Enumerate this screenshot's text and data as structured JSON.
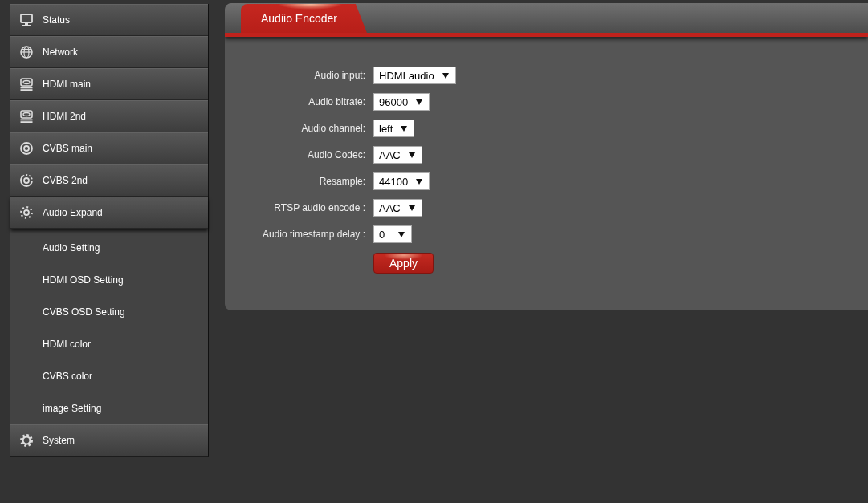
{
  "sidebar": {
    "items": [
      {
        "label": "Status"
      },
      {
        "label": "Network"
      },
      {
        "label": "HDMI main"
      },
      {
        "label": "HDMI 2nd"
      },
      {
        "label": "CVBS main"
      },
      {
        "label": "CVBS 2nd"
      },
      {
        "label": "Audio Expand",
        "expanded": true,
        "children": [
          {
            "label": "Audio Setting"
          },
          {
            "label": "HDMI OSD Setting"
          },
          {
            "label": "CVBS OSD Setting"
          },
          {
            "label": "HDMI color"
          },
          {
            "label": "CVBS color"
          },
          {
            "label": "image Setting"
          }
        ]
      },
      {
        "label": "System"
      }
    ]
  },
  "tabs": [
    {
      "label": "Audiio Encoder",
      "selected": true
    }
  ],
  "form": {
    "fields": [
      {
        "label": "Audio input:",
        "value": "HDMI audio"
      },
      {
        "label": "Audio bitrate:",
        "value": "96000"
      },
      {
        "label": "Audio channel:",
        "value": "left"
      },
      {
        "label": "Audio Codec:",
        "value": "AAC"
      },
      {
        "label": "Resample:",
        "value": "44100"
      },
      {
        "label": "RTSP audio encode :",
        "value": "AAC"
      },
      {
        "label": "Audio timestamp delay :",
        "value": "0"
      }
    ],
    "buttons": [
      "Apply"
    ]
  }
}
